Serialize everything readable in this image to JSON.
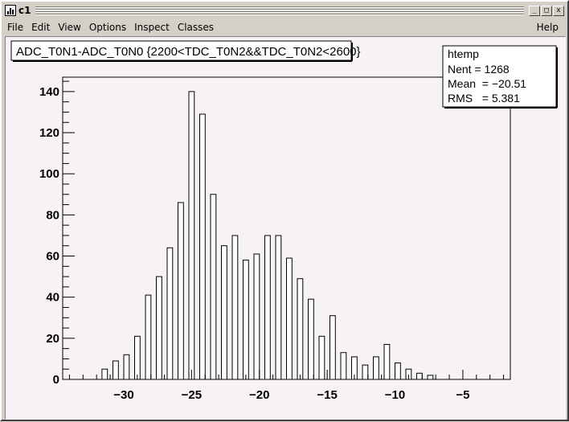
{
  "window": {
    "title": "c1"
  },
  "menu": {
    "file": "File",
    "edit": "Edit",
    "view": "View",
    "options": "Options",
    "inspect": "Inspect",
    "classes": "Classes",
    "help": "Help"
  },
  "canvas": {
    "background": "#f7f2f5"
  },
  "stats": {
    "title": "htemp",
    "nent_label": "Nent = 1268",
    "mean_label": "Mean  = −20.51",
    "rms_label": "RMS   = 5.381"
  },
  "chart_data": {
    "type": "bar",
    "title": "ADC_T0N1-ADC_T0N0 {2200<TDC_T0N2&&TDC_T0N2<2600}",
    "xlim": [
      -34.5,
      -1.5
    ],
    "ylim": [
      0,
      147
    ],
    "x_ticks": [
      -30,
      -25,
      -20,
      -15,
      -10,
      -5
    ],
    "x_tick_labels": [
      "−30",
      "−25",
      "−20",
      "−15",
      "−10",
      "−5"
    ],
    "y_ticks": [
      0,
      20,
      40,
      60,
      80,
      100,
      120,
      140
    ],
    "bin_width": 0.8,
    "bar_width": 0.4,
    "bin_centers": [
      -32.2,
      -31.4,
      -30.6,
      -29.8,
      -29.0,
      -28.2,
      -27.4,
      -26.6,
      -25.8,
      -25.0,
      -24.2,
      -23.4,
      -22.6,
      -21.8,
      -21.0,
      -20.2,
      -19.4,
      -18.6,
      -17.8,
      -17.0,
      -16.2,
      -15.4,
      -14.6,
      -13.8,
      -13.0,
      -12.2,
      -11.4,
      -10.6,
      -9.8,
      -9.0,
      -8.2,
      -7.4,
      -6.6,
      -5.8,
      -5.0,
      -4.2
    ],
    "values": [
      0,
      5,
      9,
      12,
      21,
      41,
      50,
      64,
      86,
      140,
      129,
      90,
      65,
      70,
      58,
      61,
      70,
      70,
      59,
      49,
      39,
      21,
      31,
      13,
      11,
      7,
      11,
      17,
      8,
      5,
      3,
      2,
      0,
      0,
      0,
      0
    ],
    "line_color": "#000000",
    "fill_color": "#ffffff"
  }
}
